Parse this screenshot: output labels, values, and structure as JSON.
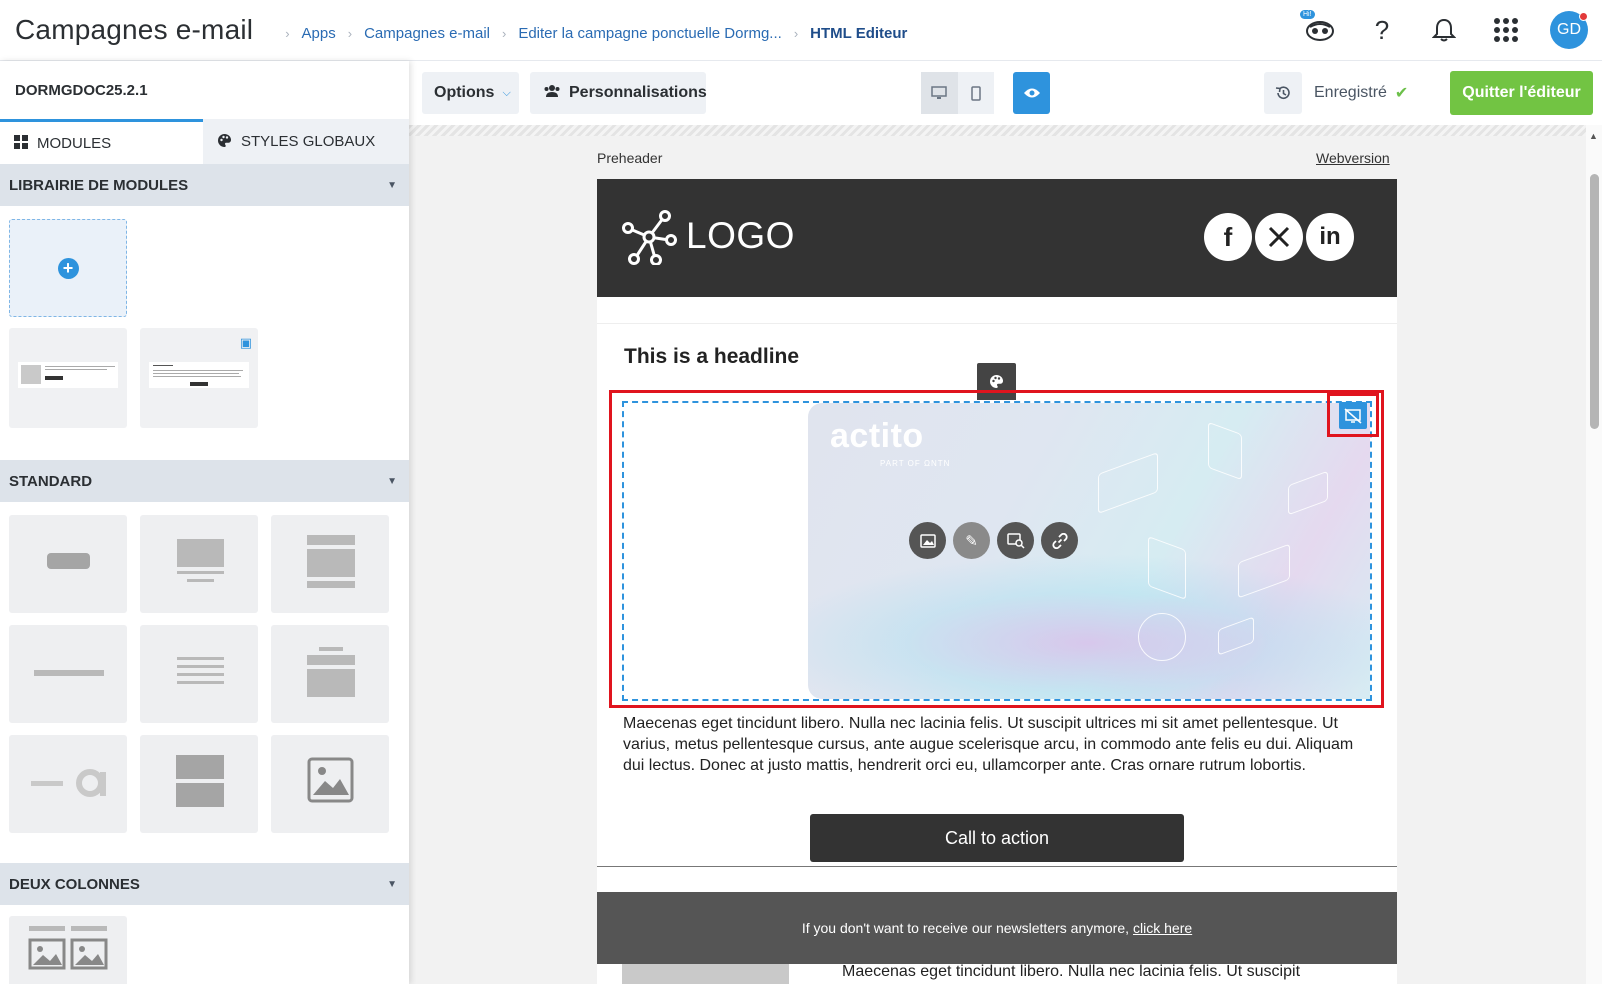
{
  "header": {
    "app_title": "Campagnes e-mail",
    "breadcrumbs": [
      "Apps",
      "Campagnes e-mail",
      "Editer la campagne ponctuelle Dormg...",
      "HTML Editeur"
    ],
    "icons": [
      "assistant-icon",
      "help-icon",
      "bell-icon",
      "apps-grid-icon"
    ],
    "assistant_badge": "Hi!",
    "avatar_initials": "GD"
  },
  "left_panel": {
    "campaign_code": "DORMGDOC25.2.1",
    "tabs": [
      {
        "label": "MODULES",
        "icon": "grid-icon",
        "active": true
      },
      {
        "label": "STYLES GLOBAUX",
        "icon": "palette-icon",
        "active": false
      }
    ],
    "sections": [
      {
        "title": "LIBRAIRIE DE MODULES"
      },
      {
        "title": "STANDARD"
      },
      {
        "title": "DEUX COLONNES"
      }
    ]
  },
  "toolbar": {
    "options_label": "Options",
    "personalisations_label": "Personnalisations",
    "saved_label": "Enregistré",
    "quit_label": "Quitter l'éditeur",
    "colors": {
      "primary": "#2e93dd",
      "success": "#72c443"
    }
  },
  "email": {
    "preheader": "Preheader",
    "webversion": "Webversion",
    "logo_text": "LOGO",
    "social": [
      "facebook-icon",
      "x-icon",
      "linkedin-icon"
    ],
    "headline": "This is a headline",
    "hero_logo": "actito",
    "hero_sub": "PART OF ΩNTN",
    "body": "Maecenas eget tincidunt libero. Nulla nec lacinia felis. Ut suscipit ultrices mi sit amet pellentesque. Ut varius, metus pellentesque cursus, ante augue scelerisque arcu, in commodo ante felis eu dui. Aliquam dui lectus. Donec at justo mattis, hendrerit orci eu, ullamcorper ante. Cras ornare rutrum lobortis.",
    "cta": "Call to action",
    "footer_text": "If you don't want to receive our newsletters anymore,",
    "footer_link": "click here",
    "next_text": "Maecenas eget tincidunt libero. Nulla nec lacinia felis. Ut suscipit"
  }
}
